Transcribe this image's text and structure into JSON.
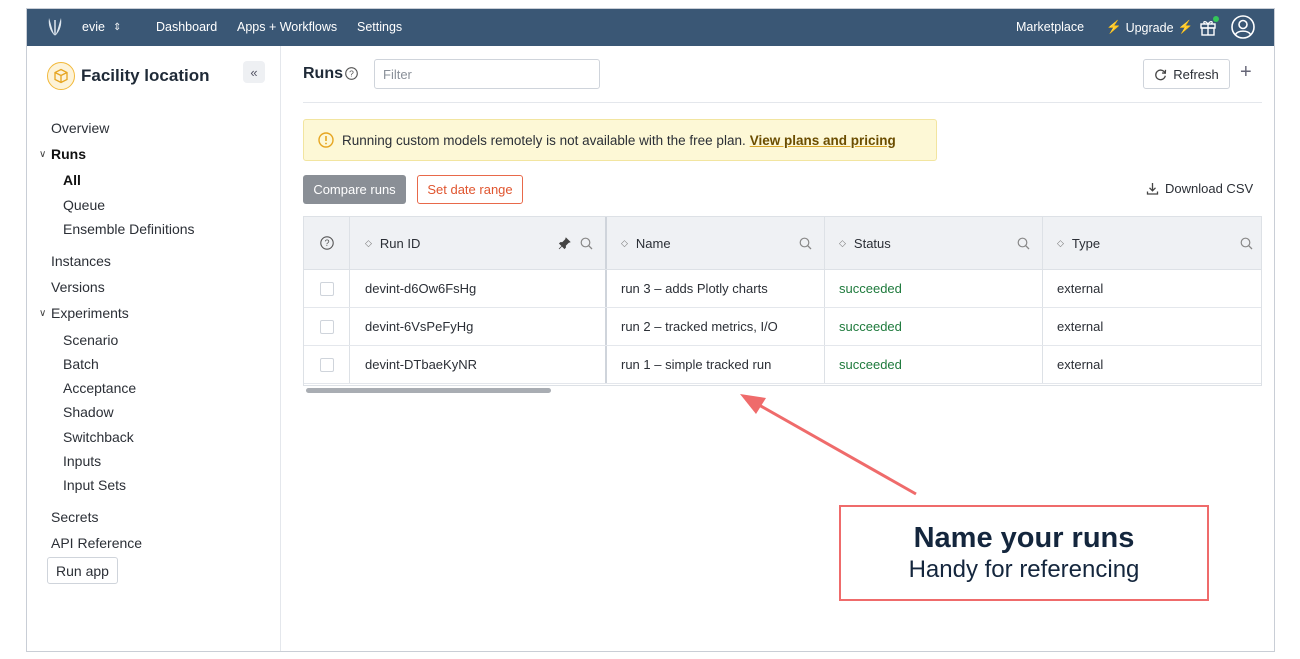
{
  "topbar": {
    "org_name": "evie",
    "nav": [
      "Dashboard",
      "Apps + Workflows",
      "Settings"
    ],
    "marketplace": "Marketplace",
    "upgrade": "Upgrade",
    "icons": [
      "nextmv-logo-icon",
      "chevron-updown-icon",
      "bolt-icon",
      "gift-icon",
      "avatar-icon"
    ],
    "notification_dot_color": "#34c759",
    "bar_color": "#3a5775"
  },
  "sidebar": {
    "app_title": "Facility location",
    "items": {
      "overview": "Overview",
      "runs": "Runs",
      "runs_all": "All",
      "runs_queue": "Queue",
      "runs_ensemble": "Ensemble Definitions",
      "instances": "Instances",
      "versions": "Versions",
      "experiments": "Experiments",
      "exp_scenario": "Scenario",
      "exp_batch": "Batch",
      "exp_acceptance": "Acceptance",
      "exp_shadow": "Shadow",
      "exp_switchback": "Switchback",
      "exp_inputs": "Inputs",
      "exp_input_sets": "Input Sets",
      "secrets": "Secrets",
      "api_reference": "API Reference"
    },
    "run_app": "Run app"
  },
  "main": {
    "title": "Runs",
    "filter_placeholder": "Filter",
    "refresh": "Refresh",
    "alert_text": "Running custom models remotely is not available with the free plan.",
    "alert_link": "View plans and pricing",
    "compare_runs": "Compare runs",
    "set_date_range": "Set date range",
    "download_csv": "Download CSV",
    "table": {
      "headers": [
        "Run ID",
        "Name",
        "Status",
        "Type"
      ],
      "rows": [
        {
          "id": "devint-d6Ow6FsHg",
          "name": "run 3 – adds Plotly charts",
          "status": "succeeded",
          "type": "external"
        },
        {
          "id": "devint-6VsPeFyHg",
          "name": "run 2 – tracked metrics, I/O",
          "status": "succeeded",
          "type": "external"
        },
        {
          "id": "devint-DTbaeKyNR",
          "name": "run 1 – simple tracked run",
          "status": "succeeded",
          "type": "external"
        }
      ]
    }
  },
  "annotation": {
    "title": "Name your runs",
    "subtitle": "Handy for referencing",
    "color": "#ef6b6b"
  }
}
